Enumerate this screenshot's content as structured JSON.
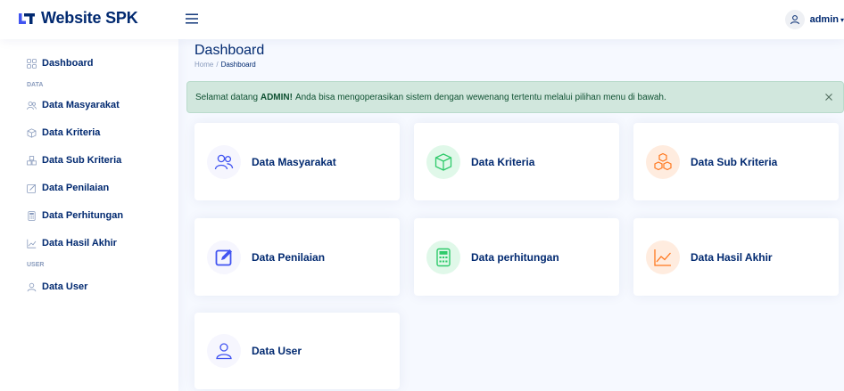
{
  "app": {
    "title": "Website SPK"
  },
  "header": {
    "username": "admin"
  },
  "sidebar": {
    "dashboard": "Dashboard",
    "heading_data": "DATA",
    "items": [
      {
        "label": "Data Masyarakat",
        "icon": "users-icon"
      },
      {
        "label": "Data Kriteria",
        "icon": "box-icon"
      },
      {
        "label": "Data Sub Kriteria",
        "icon": "boxes-icon"
      },
      {
        "label": "Data Penilaian",
        "icon": "edit-icon"
      },
      {
        "label": "Data Perhitungan",
        "icon": "calculator-icon"
      },
      {
        "label": "Data Hasil Akhir",
        "icon": "graph-icon"
      }
    ],
    "heading_user": "USER",
    "user_item": "Data User"
  },
  "page": {
    "title": "Dashboard",
    "breadcrumb_home": "Home",
    "breadcrumb_sep": "/",
    "breadcrumb_current": "Dashboard"
  },
  "alert": {
    "prefix": "Selamat datang",
    "user": "ADMIN!",
    "message": "Anda bisa mengoperasikan sistem dengan wewenang tertentu melalui pilihan menu di bawah."
  },
  "cards": [
    {
      "label": "Data Masyarakat",
      "icon": "users-icon",
      "color": "#4154f1",
      "bg": "#f6f6fe"
    },
    {
      "label": "Data Kriteria",
      "icon": "box-icon",
      "color": "#2eca6a",
      "bg": "#e0f8e9"
    },
    {
      "label": "Data Sub Kriteria",
      "icon": "boxes-icon",
      "color": "#ff771d",
      "bg": "#ffecdf"
    },
    {
      "label": "Data Penilaian",
      "icon": "edit-icon",
      "color": "#4154f1",
      "bg": "#f6f6fe"
    },
    {
      "label": "Data perhitungan",
      "icon": "calculator-icon",
      "color": "#2eca6a",
      "bg": "#e0f8e9"
    },
    {
      "label": "Data Hasil Akhir",
      "icon": "graph-icon",
      "color": "#ff771d",
      "bg": "#ffecdf"
    },
    {
      "label": "Data User",
      "icon": "person-icon",
      "color": "#4154f1",
      "bg": "#f6f6fe"
    }
  ]
}
